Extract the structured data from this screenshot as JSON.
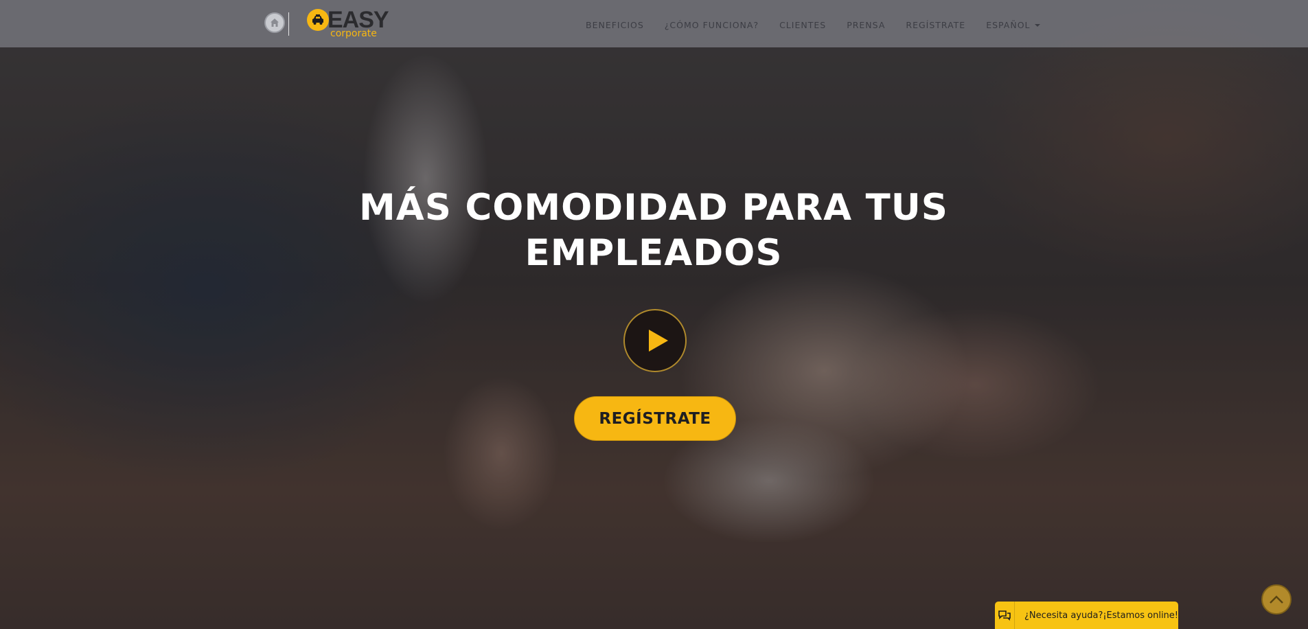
{
  "brand": {
    "name": "EASY",
    "sub": "corporate",
    "accent_color": "#f7b712"
  },
  "nav": {
    "home_icon": "home-icon",
    "items": [
      {
        "label": "BENEFICIOS"
      },
      {
        "label": "¿CÓMO FUNCIONA?"
      },
      {
        "label": "CLIENTES"
      },
      {
        "label": "PRENSA"
      },
      {
        "label": "REGÍSTRATE"
      }
    ],
    "language": {
      "label": "ESPAÑOL",
      "icon": "caret-down-icon"
    }
  },
  "hero": {
    "title_line1": "MÁS COMODIDAD PARA TUS",
    "title_line2": "EMPLEADOS",
    "play_icon": "play-icon",
    "register_label": "REGÍSTRATE"
  },
  "chat": {
    "icon": "chat-bubbles-icon",
    "label": "¿Necesita ayuda?¡Estamos online!"
  },
  "scroll_top": {
    "icon": "chevron-up-icon"
  }
}
